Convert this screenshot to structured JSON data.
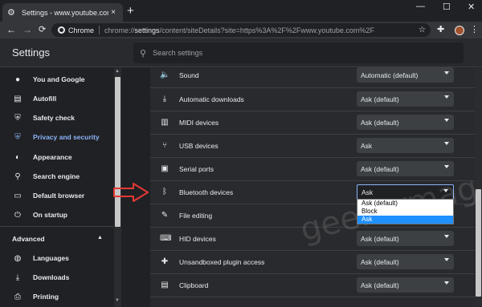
{
  "tab": {
    "title": "Settings - www.youtube.com",
    "close": "×",
    "new_tab": "+"
  },
  "window_controls": {
    "minimize": "—",
    "maximize": "☐",
    "close": "✕"
  },
  "toolbar": {
    "back": "←",
    "forward": "→",
    "reload": "C"
  },
  "omnibox": {
    "chip": "Chrome",
    "url_prefix": "chrome://",
    "url_bold": "settings",
    "url_rest": "/content/siteDetails?site=https%3A%2F%2Fwww.youtube.com%2F"
  },
  "settings": {
    "title": "Settings",
    "search_placeholder": "Search settings"
  },
  "sidebar": {
    "items": [
      {
        "label": "You and Google",
        "icon": "person-icon"
      },
      {
        "label": "Autofill",
        "icon": "clipboard-icon"
      },
      {
        "label": "Safety check",
        "icon": "shield-check-icon"
      },
      {
        "label": "Privacy and security",
        "icon": "shield-icon",
        "active": true
      },
      {
        "label": "Appearance",
        "icon": "palette-icon"
      },
      {
        "label": "Search engine",
        "icon": "search-icon"
      },
      {
        "label": "Default browser",
        "icon": "browser-icon"
      },
      {
        "label": "On startup",
        "icon": "power-icon"
      }
    ],
    "advanced": "Advanced",
    "advanced_items": [
      {
        "label": "Languages",
        "icon": "globe-icon"
      },
      {
        "label": "Downloads",
        "icon": "download-icon"
      },
      {
        "label": "Printing",
        "icon": "printer-icon"
      }
    ]
  },
  "permissions": [
    {
      "label": "Sound",
      "value": "Automatic (default)",
      "icon": "speaker-icon"
    },
    {
      "label": "Automatic downloads",
      "value": "Ask (default)",
      "icon": "download-icon"
    },
    {
      "label": "MIDI devices",
      "value": "Ask (default)",
      "icon": "midi-icon"
    },
    {
      "label": "USB devices",
      "value": "Ask",
      "icon": "usb-icon"
    },
    {
      "label": "Serial ports",
      "value": "Ask (default)",
      "icon": "serial-icon"
    },
    {
      "label": "Bluetooth devices",
      "value": "Ask",
      "icon": "bluetooth-icon",
      "open": true
    },
    {
      "label": "File editing",
      "value": "",
      "icon": "file-edit-icon"
    },
    {
      "label": "HID devices",
      "value": "Ask (default)",
      "icon": "keyboard-icon"
    },
    {
      "label": "Unsandboxed plugin access",
      "value": "Ask (default)",
      "icon": "puzzle-icon"
    },
    {
      "label": "Clipboard",
      "value": "Ask (default)",
      "icon": "clipboard-icon"
    }
  ],
  "bluetooth_dropdown": {
    "options": [
      "Ask (default)",
      "Block",
      "Ask"
    ],
    "highlighted": "Ask"
  },
  "watermark": "geekermag.com",
  "colors": {
    "accent": "#8ab4f8",
    "highlight": "#1e90ff",
    "arrow": "#e53935"
  }
}
